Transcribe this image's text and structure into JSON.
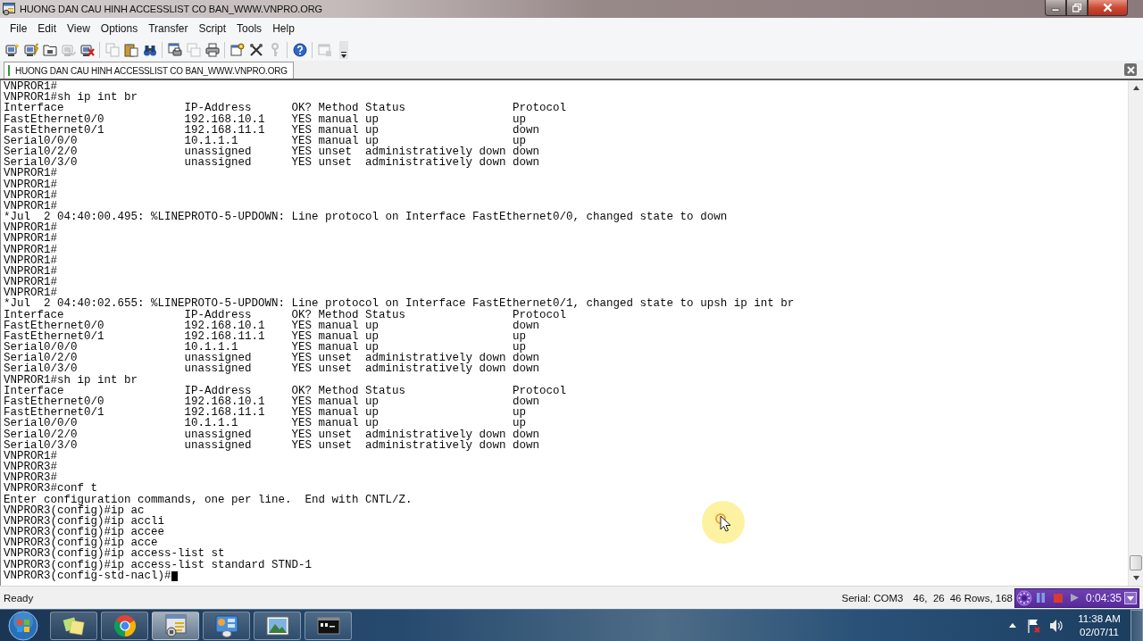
{
  "window": {
    "title": "HUONG DAN CAU HINH ACCESSLIST CO BAN_WWW.VNPRO.ORG"
  },
  "menu": [
    "File",
    "Edit",
    "View",
    "Options",
    "Transfer",
    "Script",
    "Tools",
    "Help"
  ],
  "toolbar": [
    {
      "buttons": [
        {
          "disabled": false
        },
        {
          "disabled": false
        },
        {
          "disabled": false
        },
        {
          "disabled": true
        },
        {
          "disabled": false
        }
      ]
    },
    {
      "buttons": [
        {
          "disabled": true
        },
        {
          "disabled": false
        },
        {
          "disabled": false
        }
      ]
    },
    {
      "buttons": [
        {
          "disabled": false
        },
        {
          "disabled": true
        },
        {
          "disabled": false
        }
      ]
    },
    {
      "buttons": [
        {
          "disabled": false
        },
        {
          "disabled": false
        },
        {
          "disabled": true
        }
      ]
    },
    {
      "buttons": [
        {
          "disabled": false
        }
      ]
    },
    {
      "buttons": [
        {
          "disabled": true
        }
      ]
    }
  ],
  "tabs": [
    {
      "label": "HUONG DAN CAU HINH ACCESSLIST CO BAN_WWW.VNPRO.ORG",
      "selected": true,
      "connected": true
    }
  ],
  "terminal": {
    "lines": [
      "VNPROR1#",
      "VNPROR1#sh ip int br",
      "Interface                  IP-Address      OK? Method Status                Protocol",
      "FastEthernet0/0            192.168.10.1    YES manual up                    up",
      "FastEthernet0/1            192.168.11.1    YES manual up                    down",
      "Serial0/0/0                10.1.1.1        YES manual up                    up",
      "Serial0/2/0                unassigned      YES unset  administratively down down",
      "Serial0/3/0                unassigned      YES unset  administratively down down",
      "VNPROR1#",
      "VNPROR1#",
      "VNPROR1#",
      "VNPROR1#",
      "*Jul  2 04:40:00.495: %LINEPROTO-5-UPDOWN: Line protocol on Interface FastEthernet0/0, changed state to down",
      "VNPROR1#",
      "VNPROR1#",
      "VNPROR1#",
      "VNPROR1#",
      "VNPROR1#",
      "VNPROR1#",
      "VNPROR1#",
      "*Jul  2 04:40:02.655: %LINEPROTO-5-UPDOWN: Line protocol on Interface FastEthernet0/1, changed state to upsh ip int br",
      "Interface                  IP-Address      OK? Method Status                Protocol",
      "FastEthernet0/0            192.168.10.1    YES manual up                    down",
      "FastEthernet0/1            192.168.11.1    YES manual up                    up",
      "Serial0/0/0                10.1.1.1        YES manual up                    up",
      "Serial0/2/0                unassigned      YES unset  administratively down down",
      "Serial0/3/0                unassigned      YES unset  administratively down down",
      "VNPROR1#sh ip int br",
      "Interface                  IP-Address      OK? Method Status                Protocol",
      "FastEthernet0/0            192.168.10.1    YES manual up                    down",
      "FastEthernet0/1            192.168.11.1    YES manual up                    up",
      "Serial0/0/0                10.1.1.1        YES manual up                    up",
      "Serial0/2/0                unassigned      YES unset  administratively down down",
      "Serial0/3/0                unassigned      YES unset  administratively down down",
      "VNPROR1#",
      "VNPROR3#",
      "VNPROR3#",
      "VNPROR3#conf t",
      "Enter configuration commands, one per line.  End with CNTL/Z.",
      "VNPROR3(config)#ip ac",
      "VNPROR3(config)#ip accli",
      "VNPROR3(config)#ip accee",
      "VNPROR3(config)#ip acce",
      "VNPROR3(config)#ip access-list st",
      "VNPROR3(config)#ip access-list standard STND-1",
      "VNPROR3(config-std-nacl)#"
    ],
    "cursor": true
  },
  "status_bar": {
    "message": "Ready",
    "connection": "Serial: COM3",
    "position": "46,  26",
    "size": "46 Rows, 168"
  },
  "recorder": {
    "time": "0:04:35"
  },
  "taskbar": {
    "apps": [
      {
        "selected": false
      },
      {
        "selected": false
      },
      {
        "selected": true
      },
      {
        "selected": false
      },
      {
        "selected": false
      },
      {
        "selected": false
      }
    ],
    "clock": {
      "time": "11:38 AM",
      "date": "02/07/11"
    }
  }
}
